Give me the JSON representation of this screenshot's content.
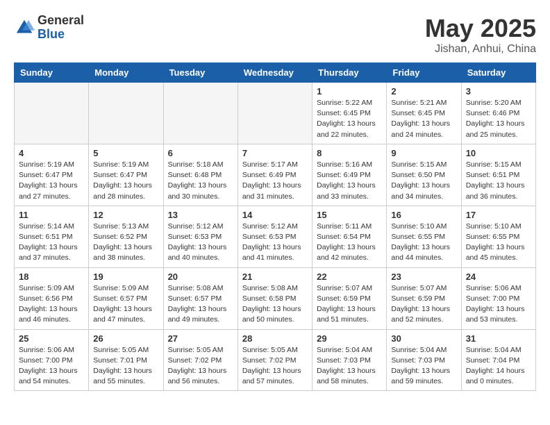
{
  "logo": {
    "general": "General",
    "blue": "Blue"
  },
  "title": "May 2025",
  "subtitle": "Jishan, Anhui, China",
  "days_header": [
    "Sunday",
    "Monday",
    "Tuesday",
    "Wednesday",
    "Thursday",
    "Friday",
    "Saturday"
  ],
  "weeks": [
    [
      {
        "num": "",
        "info": ""
      },
      {
        "num": "",
        "info": ""
      },
      {
        "num": "",
        "info": ""
      },
      {
        "num": "",
        "info": ""
      },
      {
        "num": "1",
        "info": "Sunrise: 5:22 AM\nSunset: 6:45 PM\nDaylight: 13 hours and 22 minutes."
      },
      {
        "num": "2",
        "info": "Sunrise: 5:21 AM\nSunset: 6:45 PM\nDaylight: 13 hours and 24 minutes."
      },
      {
        "num": "3",
        "info": "Sunrise: 5:20 AM\nSunset: 6:46 PM\nDaylight: 13 hours and 25 minutes."
      }
    ],
    [
      {
        "num": "4",
        "info": "Sunrise: 5:19 AM\nSunset: 6:47 PM\nDaylight: 13 hours and 27 minutes."
      },
      {
        "num": "5",
        "info": "Sunrise: 5:19 AM\nSunset: 6:47 PM\nDaylight: 13 hours and 28 minutes."
      },
      {
        "num": "6",
        "info": "Sunrise: 5:18 AM\nSunset: 6:48 PM\nDaylight: 13 hours and 30 minutes."
      },
      {
        "num": "7",
        "info": "Sunrise: 5:17 AM\nSunset: 6:49 PM\nDaylight: 13 hours and 31 minutes."
      },
      {
        "num": "8",
        "info": "Sunrise: 5:16 AM\nSunset: 6:49 PM\nDaylight: 13 hours and 33 minutes."
      },
      {
        "num": "9",
        "info": "Sunrise: 5:15 AM\nSunset: 6:50 PM\nDaylight: 13 hours and 34 minutes."
      },
      {
        "num": "10",
        "info": "Sunrise: 5:15 AM\nSunset: 6:51 PM\nDaylight: 13 hours and 36 minutes."
      }
    ],
    [
      {
        "num": "11",
        "info": "Sunrise: 5:14 AM\nSunset: 6:51 PM\nDaylight: 13 hours and 37 minutes."
      },
      {
        "num": "12",
        "info": "Sunrise: 5:13 AM\nSunset: 6:52 PM\nDaylight: 13 hours and 38 minutes."
      },
      {
        "num": "13",
        "info": "Sunrise: 5:12 AM\nSunset: 6:53 PM\nDaylight: 13 hours and 40 minutes."
      },
      {
        "num": "14",
        "info": "Sunrise: 5:12 AM\nSunset: 6:53 PM\nDaylight: 13 hours and 41 minutes."
      },
      {
        "num": "15",
        "info": "Sunrise: 5:11 AM\nSunset: 6:54 PM\nDaylight: 13 hours and 42 minutes."
      },
      {
        "num": "16",
        "info": "Sunrise: 5:10 AM\nSunset: 6:55 PM\nDaylight: 13 hours and 44 minutes."
      },
      {
        "num": "17",
        "info": "Sunrise: 5:10 AM\nSunset: 6:55 PM\nDaylight: 13 hours and 45 minutes."
      }
    ],
    [
      {
        "num": "18",
        "info": "Sunrise: 5:09 AM\nSunset: 6:56 PM\nDaylight: 13 hours and 46 minutes."
      },
      {
        "num": "19",
        "info": "Sunrise: 5:09 AM\nSunset: 6:57 PM\nDaylight: 13 hours and 47 minutes."
      },
      {
        "num": "20",
        "info": "Sunrise: 5:08 AM\nSunset: 6:57 PM\nDaylight: 13 hours and 49 minutes."
      },
      {
        "num": "21",
        "info": "Sunrise: 5:08 AM\nSunset: 6:58 PM\nDaylight: 13 hours and 50 minutes."
      },
      {
        "num": "22",
        "info": "Sunrise: 5:07 AM\nSunset: 6:59 PM\nDaylight: 13 hours and 51 minutes."
      },
      {
        "num": "23",
        "info": "Sunrise: 5:07 AM\nSunset: 6:59 PM\nDaylight: 13 hours and 52 minutes."
      },
      {
        "num": "24",
        "info": "Sunrise: 5:06 AM\nSunset: 7:00 PM\nDaylight: 13 hours and 53 minutes."
      }
    ],
    [
      {
        "num": "25",
        "info": "Sunrise: 5:06 AM\nSunset: 7:00 PM\nDaylight: 13 hours and 54 minutes."
      },
      {
        "num": "26",
        "info": "Sunrise: 5:05 AM\nSunset: 7:01 PM\nDaylight: 13 hours and 55 minutes."
      },
      {
        "num": "27",
        "info": "Sunrise: 5:05 AM\nSunset: 7:02 PM\nDaylight: 13 hours and 56 minutes."
      },
      {
        "num": "28",
        "info": "Sunrise: 5:05 AM\nSunset: 7:02 PM\nDaylight: 13 hours and 57 minutes."
      },
      {
        "num": "29",
        "info": "Sunrise: 5:04 AM\nSunset: 7:03 PM\nDaylight: 13 hours and 58 minutes."
      },
      {
        "num": "30",
        "info": "Sunrise: 5:04 AM\nSunset: 7:03 PM\nDaylight: 13 hours and 59 minutes."
      },
      {
        "num": "31",
        "info": "Sunrise: 5:04 AM\nSunset: 7:04 PM\nDaylight: 14 hours and 0 minutes."
      }
    ]
  ]
}
